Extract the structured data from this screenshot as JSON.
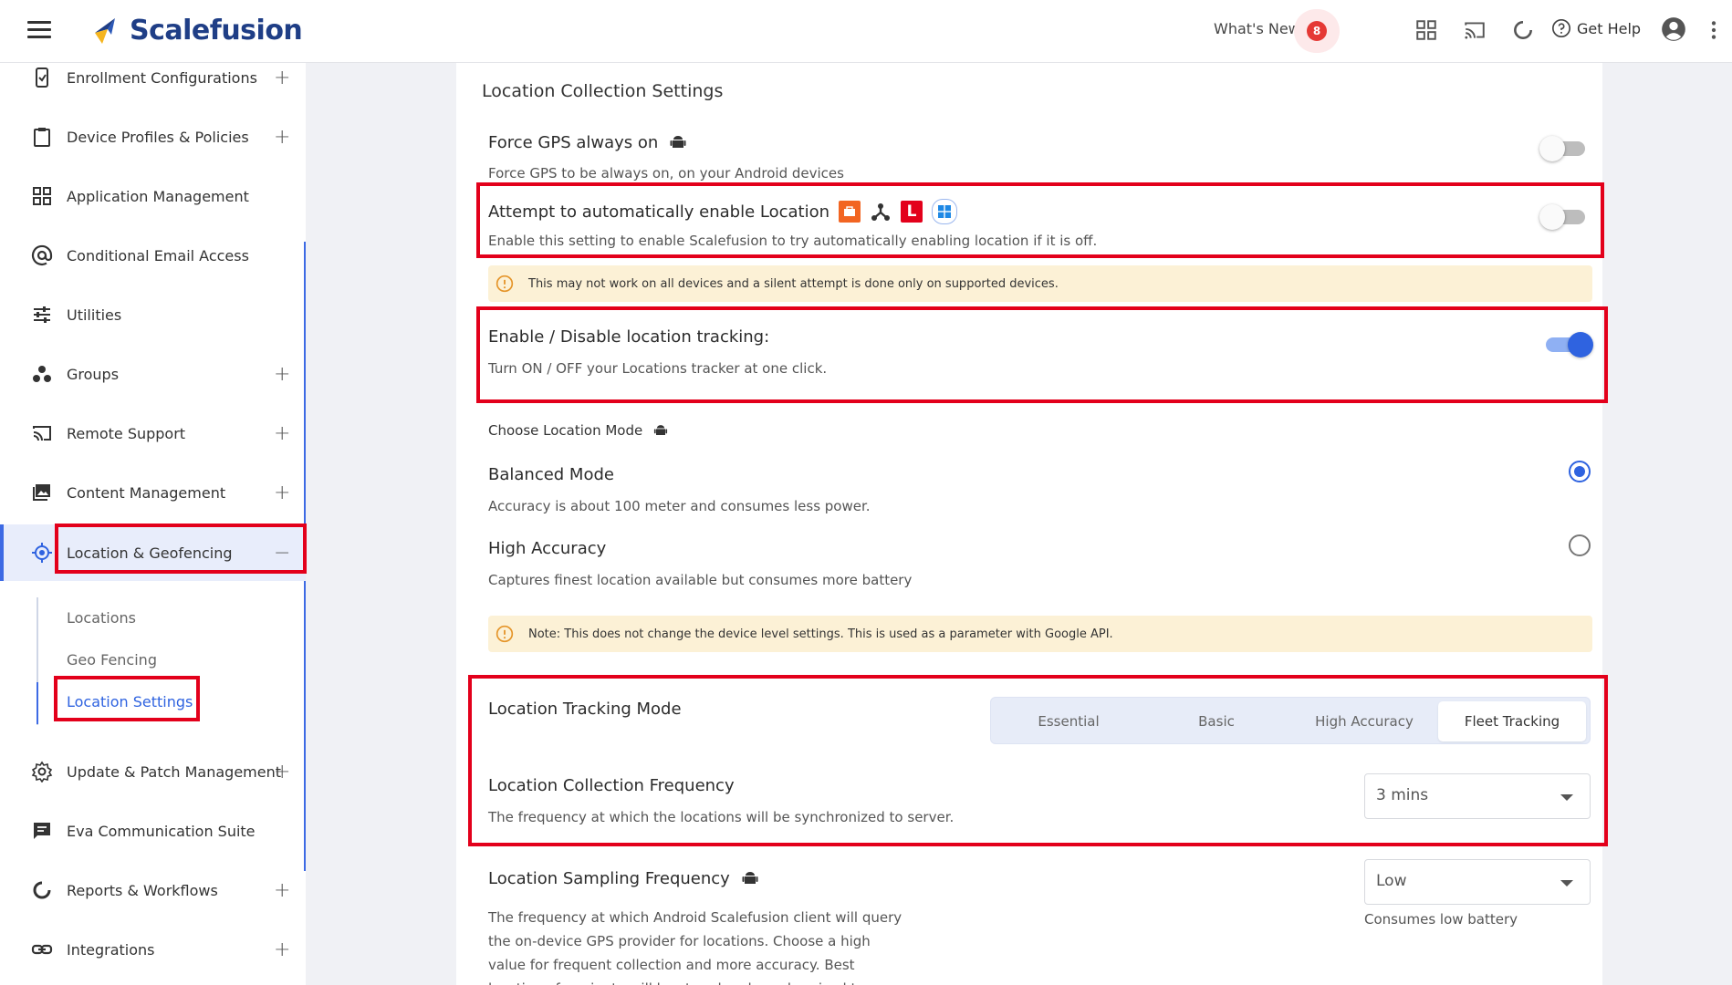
{
  "header": {
    "brand": "Scalefusion",
    "whats_new": "What's New",
    "badge_count": "8",
    "get_help": "Get Help"
  },
  "sidebar": {
    "items": [
      {
        "label": "Enrollment Configurations",
        "expand": "+"
      },
      {
        "label": "Device Profiles & Policies",
        "expand": "+"
      },
      {
        "label": "Application Management",
        "expand": ""
      },
      {
        "label": "Conditional Email Access",
        "expand": ""
      },
      {
        "label": "Utilities",
        "expand": ""
      },
      {
        "label": "Groups",
        "expand": "+"
      },
      {
        "label": "Remote Support",
        "expand": "+"
      },
      {
        "label": "Content Management",
        "expand": "+"
      },
      {
        "label": "Location & Geofencing",
        "expand": "−"
      },
      {
        "label": "Update & Patch Management",
        "expand": "+"
      },
      {
        "label": "Eva Communication Suite",
        "expand": ""
      },
      {
        "label": "Reports & Workflows",
        "expand": "+"
      },
      {
        "label": "Integrations",
        "expand": "+"
      }
    ],
    "subitems": [
      {
        "label": "Locations"
      },
      {
        "label": "Geo Fencing"
      },
      {
        "label": "Location Settings"
      }
    ]
  },
  "main": {
    "section_title": "Location Collection Settings",
    "force_gps": {
      "title": "Force GPS always on",
      "desc": "Force GPS to be always on, on your Android devices",
      "enabled": false
    },
    "auto_enable": {
      "title": "Attempt to automatically enable Location",
      "desc": "Enable this setting to enable Scalefusion to try automatically enabling location if it is off.",
      "enabled": false
    },
    "alert1": "This may not work on all devices and a silent attempt is done only on supported devices.",
    "tracking": {
      "title": "Enable / Disable location tracking:",
      "desc": "Turn ON / OFF your Locations tracker at one click.",
      "enabled": true
    },
    "mode_label": "Choose Location Mode",
    "balanced": {
      "title": "Balanced Mode",
      "desc": "Accuracy is about 100 meter and consumes less power.",
      "selected": true
    },
    "high_accuracy": {
      "title": "High Accuracy",
      "desc": "Captures finest location available but consumes more battery",
      "selected": false
    },
    "alert2": "Note: This does not change the device level settings. This is used as a parameter with Google API.",
    "tracking_mode": {
      "title": "Location Tracking Mode",
      "options": [
        "Essential",
        "Basic",
        "High Accuracy",
        "Fleet Tracking"
      ],
      "selected": "Fleet Tracking"
    },
    "collection_freq": {
      "title": "Location Collection Frequency",
      "desc": "The frequency at which the locations will be synchronized to server.",
      "value": "3 mins"
    },
    "sampling_freq": {
      "title": "Location Sampling Frequency",
      "desc": "The frequency at which Android Scalefusion client will query the on-device GPS provider for locations. Choose a high value for frequent collection and more accuracy. Best location of a minute will be stored and synchronized to",
      "value": "Low",
      "helper": "Consumes low battery"
    }
  },
  "colors": {
    "accent": "#2f63e0",
    "highlight": "#e3001b",
    "alert_bg": "#fcf1d6"
  }
}
